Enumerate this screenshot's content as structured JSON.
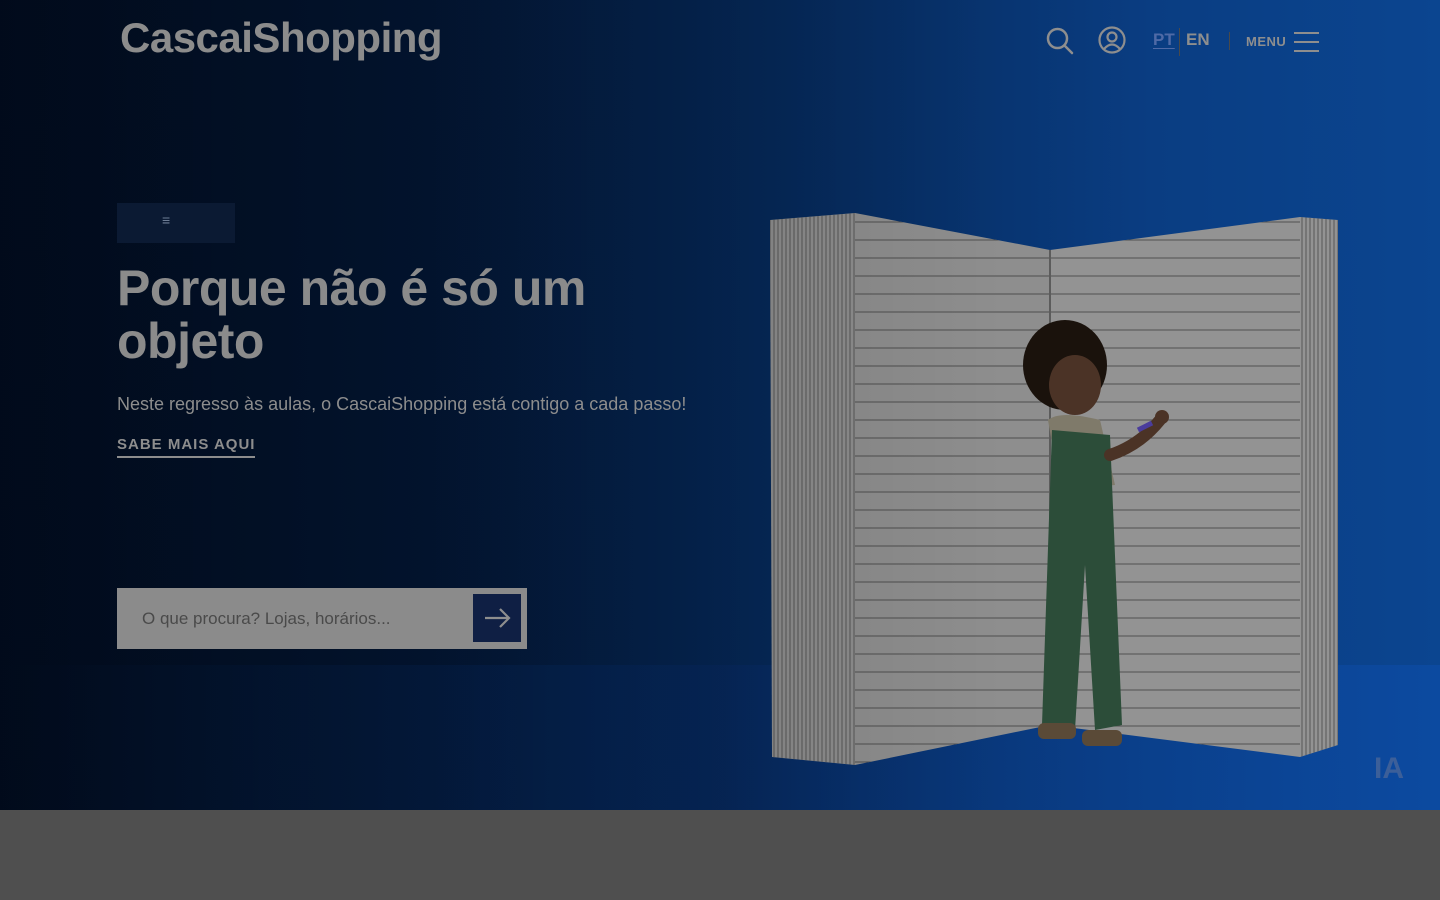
{
  "header": {
    "logo": "CascaiShopping",
    "icons": {
      "search": "search-icon",
      "account": "user-circle-icon",
      "menu": "hamburger-menu-icon"
    },
    "languages": [
      {
        "code": "PT",
        "active": true
      },
      {
        "code": "EN",
        "active": false
      }
    ],
    "menu_label": "MENU"
  },
  "hero": {
    "badge_text": "≡",
    "title": "Porque não é só um objeto",
    "subtitle": "Neste regresso às aulas, o CascaiShopping está contigo a cada passo!",
    "link_label": "SABE MAIS AQUI",
    "image_alt": "child-writing-on-giant-notebook",
    "corner_mark": "IA"
  },
  "search": {
    "placeholder": "O que procura? Lojas, horários...",
    "value": "",
    "button_icon": "arrow-right-icon"
  },
  "colors": {
    "hero_dark": "#021029",
    "hero_light": "#0b4590",
    "search_button": "#0f1f44",
    "overlay_gray": "#4f4f4f",
    "active_language": "#4f6aa6"
  }
}
